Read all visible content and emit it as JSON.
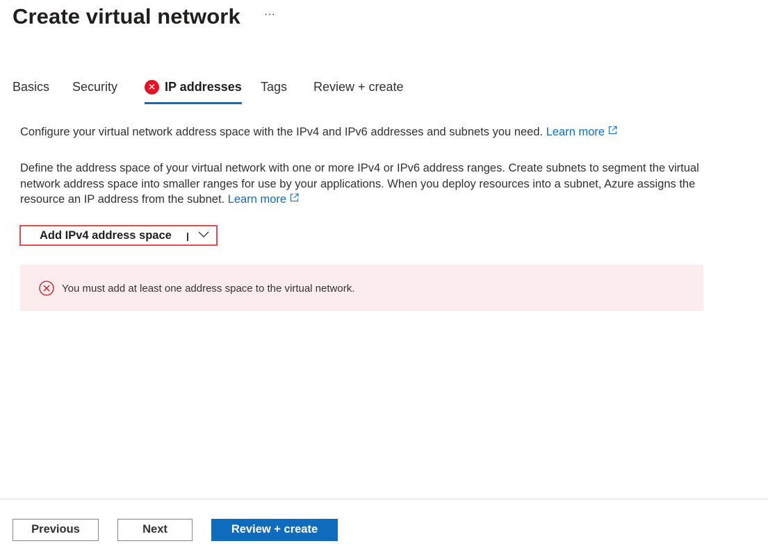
{
  "header": {
    "title": "Create virtual network",
    "more_label": "···"
  },
  "tabs": [
    {
      "label": "Basics",
      "active": false,
      "error": false
    },
    {
      "label": "Security",
      "active": false,
      "error": false
    },
    {
      "label": "IP addresses",
      "active": true,
      "error": true
    },
    {
      "label": "Tags",
      "active": false,
      "error": false
    },
    {
      "label": "Review + create",
      "active": false,
      "error": false
    }
  ],
  "main": {
    "intro_text": "Configure your virtual network address space with the IPv4 and IPv6 addresses and subnets you need.",
    "intro_link": "Learn more",
    "detail_text": "Define the address space of your virtual network with one or more IPv4 or IPv6 address ranges. Create subnets to segment the virtual network address space into smaller ranges for use by your applications. When you deploy resources into a subnet, Azure assigns the resource an IP address from the subnet.",
    "detail_link": "Learn more",
    "add_space_button": "Add IPv4 address space",
    "error_message": "You must add at least one address space to the virtual network."
  },
  "footer": {
    "previous": "Previous",
    "next": "Next",
    "review_create": "Review + create"
  },
  "colors": {
    "accent": "#0f6cbd",
    "error": "#e81123",
    "error_banner_bg": "#fdeced",
    "highlight_border": "#e04a50"
  },
  "icons": {
    "more": "more-options-icon",
    "tab_error": "error-badge-icon",
    "external_link": "external-link-icon",
    "dropdown": "chevron-down-icon",
    "error": "error-circle-icon"
  }
}
